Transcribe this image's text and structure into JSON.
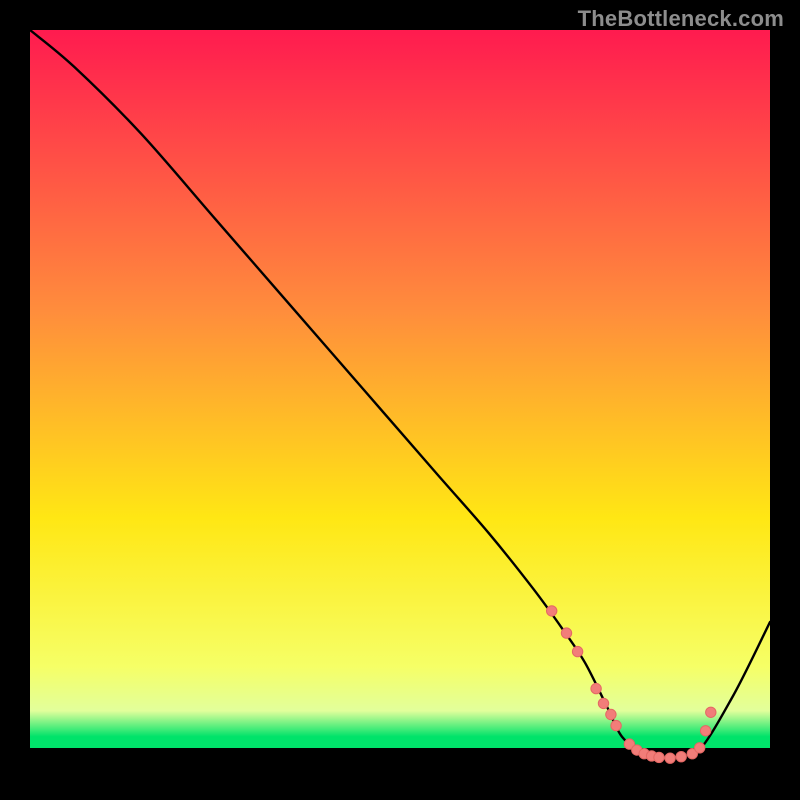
{
  "watermark": "TheBottleneck.com",
  "colors": {
    "curve": "#000000",
    "marker_fill": "#f27d79",
    "marker_stroke": "#e46864",
    "grad_top": "#ff1b4f",
    "grad_mid_high": "#ff8d3c",
    "grad_mid": "#ffe714",
    "grad_low": "#f6ff66",
    "grad_band_pale": "#e2ff9b",
    "grad_band_green": "#00e36a",
    "bg": "#000000"
  },
  "chart_data": {
    "type": "line",
    "title": "",
    "xlabel": "",
    "ylabel": "",
    "xlim": [
      0,
      100
    ],
    "ylim": [
      0,
      100
    ],
    "series": [
      {
        "name": "bottleneck-curve",
        "x": [
          0,
          6,
          15,
          25,
          35,
          45,
          55,
          62,
          68,
          72,
          75,
          78,
          80,
          83,
          86,
          90,
          95,
          100
        ],
        "y": [
          100,
          95,
          86,
          74.5,
          63,
          51.5,
          40,
          32,
          24.5,
          19,
          14.5,
          8.5,
          4.5,
          2.2,
          1.6,
          2.2,
          10,
          20
        ]
      }
    ],
    "markers": {
      "name": "highlight-points",
      "x": [
        70.5,
        72.5,
        74,
        76.5,
        77.5,
        78.5,
        79.2,
        81,
        82,
        83,
        84,
        85,
        86.5,
        88,
        89.5,
        90.5,
        91.3,
        92
      ],
      "y": [
        21.5,
        18.5,
        16,
        11,
        9,
        7.5,
        6,
        3.5,
        2.7,
        2.2,
        1.9,
        1.7,
        1.6,
        1.8,
        2.2,
        3,
        5.3,
        7.8
      ]
    }
  }
}
